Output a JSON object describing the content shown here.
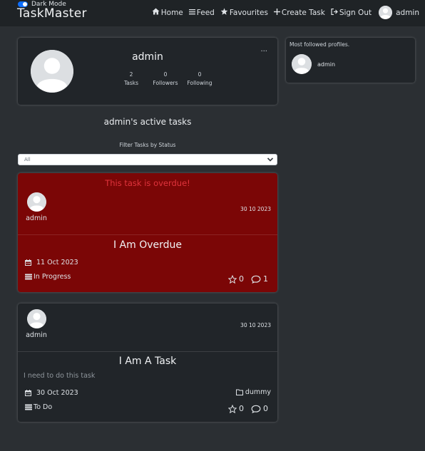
{
  "navbar": {
    "dark_mode_label": "Dark Mode",
    "brand": "TaskMaster",
    "links": {
      "home": "Home",
      "feed": "Feed",
      "favourites": "Favourites",
      "create_task": "Create Task",
      "sign_out": "Sign Out"
    },
    "user": "admin"
  },
  "profile": {
    "name": "admin",
    "menu_glyph": "···",
    "stats": [
      {
        "value": "2",
        "label": "Tasks"
      },
      {
        "value": "0",
        "label": "Followers"
      },
      {
        "value": "0",
        "label": "Following"
      }
    ]
  },
  "followed": {
    "title": "Most followed profiles.",
    "items": [
      {
        "name": "admin"
      }
    ]
  },
  "tasks_section": {
    "title": "admin's active tasks",
    "filter_label": "Filter Tasks by Status",
    "filter_value": "All"
  },
  "tasks": [
    {
      "overdue_message": "This task is overdue!",
      "author": "admin",
      "created": "30 10 2023",
      "title": "I Am Overdue",
      "due_date": "11 Oct 2023",
      "status": "In Progress",
      "likes": "0",
      "comments": "1"
    },
    {
      "author": "admin",
      "created": "30 10 2023",
      "title": "I Am A Task",
      "description": "I need to do this task",
      "due_date": "30 Oct 2023",
      "status": "To Do",
      "tag": "dummy",
      "likes": "0",
      "comments": "0"
    }
  ],
  "colors": {
    "page_bg": "#2b2f33",
    "navbar_bg": "#1f2326",
    "card_bg": "#212529",
    "overdue_bg": "#7b0606",
    "overdue_text": "#e0343c",
    "toggle_accent": "#0d6efd"
  }
}
